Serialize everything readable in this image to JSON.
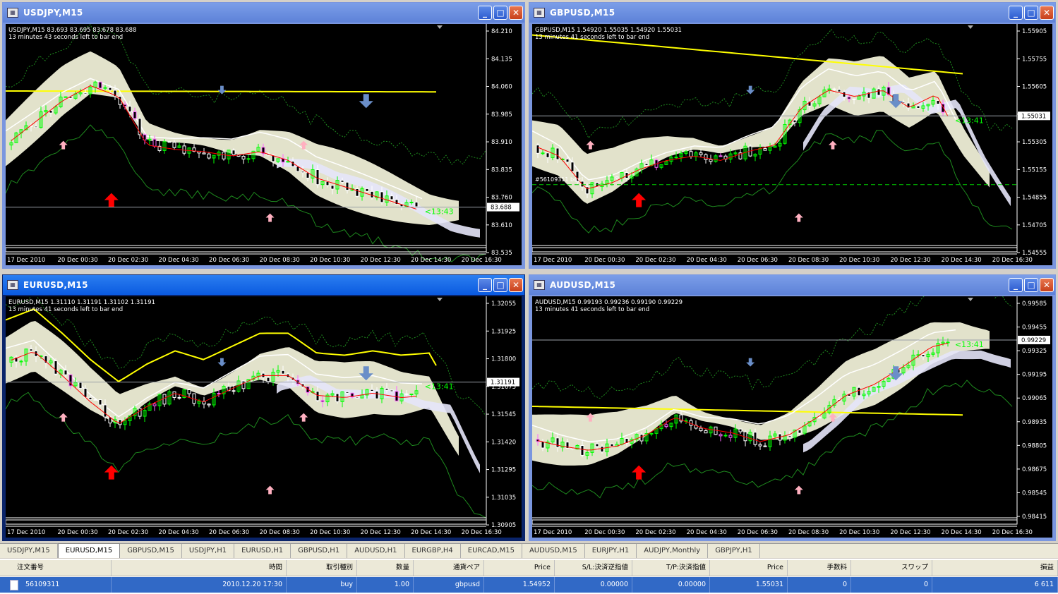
{
  "windows": [
    {
      "key": "usdjpy",
      "title": "USDJPY,M15",
      "ohlc": "USDJPY,M15  83.693 83.695 83.678 83.688",
      "timer": "13 minutes 43 seconds left to bar end",
      "prices": [
        "84.210",
        "84.135",
        "84.060",
        "83.985",
        "83.910",
        "83.835",
        "83.760",
        "83.610",
        "83.535"
      ],
      "current": "83.688",
      "countdown": "<13:43",
      "times": [
        "17 Dec 2010",
        "20 Dec 00:30",
        "20 Dec 02:30",
        "20 Dec 04:30",
        "20 Dec 06:30",
        "20 Dec 08:30",
        "20 Dec 10:30",
        "20 Dec 12:30",
        "20 Dec 14:30",
        "20 Dec 16:30"
      ]
    },
    {
      "key": "gbpusd",
      "title": "GBPUSD,M15",
      "ohlc": "GBPUSD,M15  1.54920 1.55035 1.54920 1.55031",
      "timer": "13 minutes 41 seconds left to bar end",
      "prices": [
        "1.55905",
        "1.55755",
        "1.55605",
        "1.55455",
        "1.55305",
        "1.55155",
        "1.54855",
        "1.54705",
        "1.54555"
      ],
      "current": "1.55031",
      "countdown": "<13:41",
      "order": "#56109311 buy",
      "times": [
        "17 Dec 2010",
        "20 Dec 00:30",
        "20 Dec 02:30",
        "20 Dec 04:30",
        "20 Dec 06:30",
        "20 Dec 08:30",
        "20 Dec 10:30",
        "20 Dec 12:30",
        "20 Dec 14:30",
        "20 Dec 16:30"
      ]
    },
    {
      "key": "eurusd",
      "title": "EURUSD,M15",
      "ohlc": "EURUSD,M15  1.31110 1.31191 1.31102 1.31191",
      "timer": "13 minutes 41 seconds left to bar end",
      "prices": [
        "1.32055",
        "1.31925",
        "1.31800",
        "1.31675",
        "1.31545",
        "1.31420",
        "1.31295",
        "1.31035",
        "1.30905"
      ],
      "current": "1.31191",
      "countdown": "<13:41",
      "times": [
        "17 Dec 2010",
        "20 Dec 00:30",
        "20 Dec 02:30",
        "20 Dec 04:30",
        "20 Dec 06:30",
        "20 Dec 08:30",
        "20 Dec 10:30",
        "20 Dec 12:30",
        "20 Dec 14:30",
        "20 Dec 16:30"
      ]
    },
    {
      "key": "audusd",
      "title": "AUDUSD,M15",
      "ohlc": "AUDUSD,M15  0.99193 0.99236 0.99190 0.99229",
      "timer": "13 minutes 41 seconds left to bar end",
      "prices": [
        "0.99585",
        "0.99455",
        "0.99325",
        "0.99195",
        "0.99065",
        "0.98935",
        "0.98805",
        "0.98675",
        "0.98545",
        "0.98415"
      ],
      "current": "0.99229",
      "countdown": "<13:41",
      "times": [
        "17 Dec 2010",
        "20 Dec 00:30",
        "20 Dec 02:30",
        "20 Dec 04:30",
        "20 Dec 06:30",
        "20 Dec 08:30",
        "20 Dec 10:30",
        "20 Dec 12:30",
        "20 Dec 14:30",
        "20 Dec 16:30"
      ]
    }
  ],
  "tabs": [
    "USDJPY,M15",
    "EURUSD,M15",
    "GBPUSD,M15",
    "USDJPY,H1",
    "EURUSD,H1",
    "GBPUSD,H1",
    "AUDUSD,H1",
    "EURGBP,H4",
    "EURCAD,M15",
    "AUDUSD,M15",
    "EURJPY,H1",
    "AUDJPY,Monthly",
    "GBPJPY,H1"
  ],
  "active_tab": "EURUSD,M15",
  "orders": {
    "headers": [
      "注文番号",
      "時間",
      "取引種別",
      "数量",
      "通貨ペア",
      "Price",
      "S/L:決済逆指値",
      "T/P:決済指値",
      "Price",
      "手数料",
      "スワップ",
      "損益"
    ],
    "row": [
      "56109311",
      "2010.12.20 17:30",
      "buy",
      "1.00",
      "gbpusd",
      "1.54952",
      "0.00000",
      "0.00000",
      "1.55031",
      "0",
      "0",
      "6 611"
    ]
  },
  "colors": {
    "candle_up": "#00ff00",
    "candle_down": "#ffffff",
    "ma_fast": "#ff0000",
    "ma_slow": "#ffff00",
    "cloud_a": "#f5f5dc",
    "cloud_b": "#e6e6fa",
    "arrow_buy": "#ff0000",
    "arrow_sell": "#6a8ec8"
  }
}
